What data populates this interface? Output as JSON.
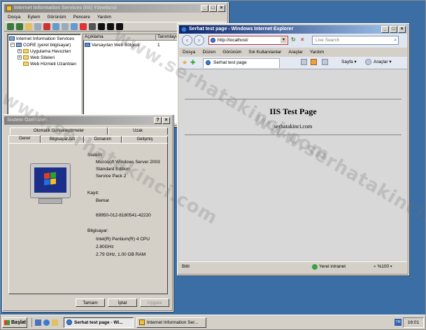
{
  "iis": {
    "title": "Internet Information Services (IIS) Yöneticisi",
    "menu": [
      "Dosya",
      "Eylem",
      "Görünüm",
      "Pencere",
      "Yardım"
    ],
    "tree": [
      "Internet Information Services",
      "CORE (yerel bilgisayar)",
      "Uygulama Havuzları",
      "Web Siteleri",
      "Web Hizmeti Uzantıları"
    ],
    "columns": [
      "Açıklama",
      "Tanımlayıcı"
    ],
    "row": {
      "name": "Varsayılan Web Bölgesi",
      "id": "1"
    }
  },
  "sys": {
    "title": "Sistem Özellikleri",
    "tabs_back": [
      "Otomatik Güncelleştirmeler",
      "Uzak"
    ],
    "tabs_front": [
      "Genel",
      "Bilgisayar Adı",
      "Donanım",
      "Gelişmiş"
    ],
    "system_label": "Sistem:",
    "system_lines": [
      "Microsoft Windows Server 2003",
      "Standard Edition",
      "Service Pack 2"
    ],
    "reg_label": "Kayıt:",
    "reg_lines": [
      "Bemar",
      "",
      "69950-012-8180541-42220"
    ],
    "comp_label": "Bilgisayar:",
    "comp_lines": [
      "Intel(R) Pentium(R) 4 CPU",
      "2.80GHz",
      "2.79 GHz, 1.00 GB RAM"
    ],
    "buttons": [
      "Tamam",
      "İptal",
      "Uygula"
    ]
  },
  "ie": {
    "title": "Serhat test page - Windows Internet Explorer",
    "address": "http://localhost/",
    "search_placeholder": "Live Search",
    "menu": [
      "Dosya",
      "Düzen",
      "Görünüm",
      "Sık Kullanılanlar",
      "Araçlar",
      "Yardım"
    ],
    "tab_label": "Serhat test page",
    "cmd": [
      "Sayfa",
      "Araçlar"
    ],
    "page_heading": "IIS Test Page",
    "page_sub": "serhatakinci.com",
    "status_left": "Bitti",
    "status_zone": "Yerel intranet",
    "zoom": "%100"
  },
  "taskbar": {
    "start": "Başlat",
    "items": [
      "Serhat test page - Wi...",
      "Internet Information Ser..."
    ],
    "lang": "TR",
    "clock": "16:01"
  },
  "watermark": "www.serhatakinci.com"
}
